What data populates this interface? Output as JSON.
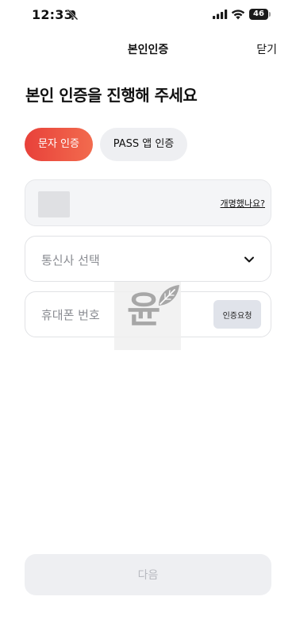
{
  "status_bar": {
    "time": "12:33",
    "battery": "46"
  },
  "header": {
    "title": "본인인증",
    "close_label": "닫기"
  },
  "heading": "본인 인증을 진행해 주세요",
  "tabs": [
    {
      "label": "문자 인증",
      "active": true
    },
    {
      "label": "PASS 앱 인증",
      "active": false
    }
  ],
  "form": {
    "renamed_link": "개명했나요?",
    "carrier_placeholder": "통신사 선택",
    "phone_placeholder": "휴대폰 번호",
    "verify_button": "인증요청"
  },
  "watermark_text": "윤",
  "next_button": "다음",
  "colors": {
    "accent_start": "#e8413a",
    "accent_end": "#f26b4e"
  }
}
